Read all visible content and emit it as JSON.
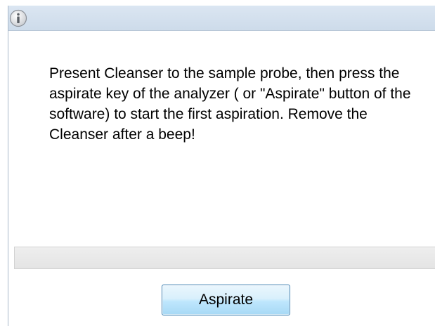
{
  "dialog": {
    "icon": "info-icon",
    "message": "Present Cleanser to the sample probe, then press the aspirate key of the analyzer ( or \"Aspirate\" button of the software) to start the first aspiration. Remove the Cleanser after a beep!",
    "progress": 0,
    "aspirate_label": "Aspirate"
  },
  "colors": {
    "titlebar": "#d4e0ee",
    "button_border": "#3c7fb1",
    "button_fill": "#bee6fd",
    "progress_track": "#e8e8e8"
  }
}
